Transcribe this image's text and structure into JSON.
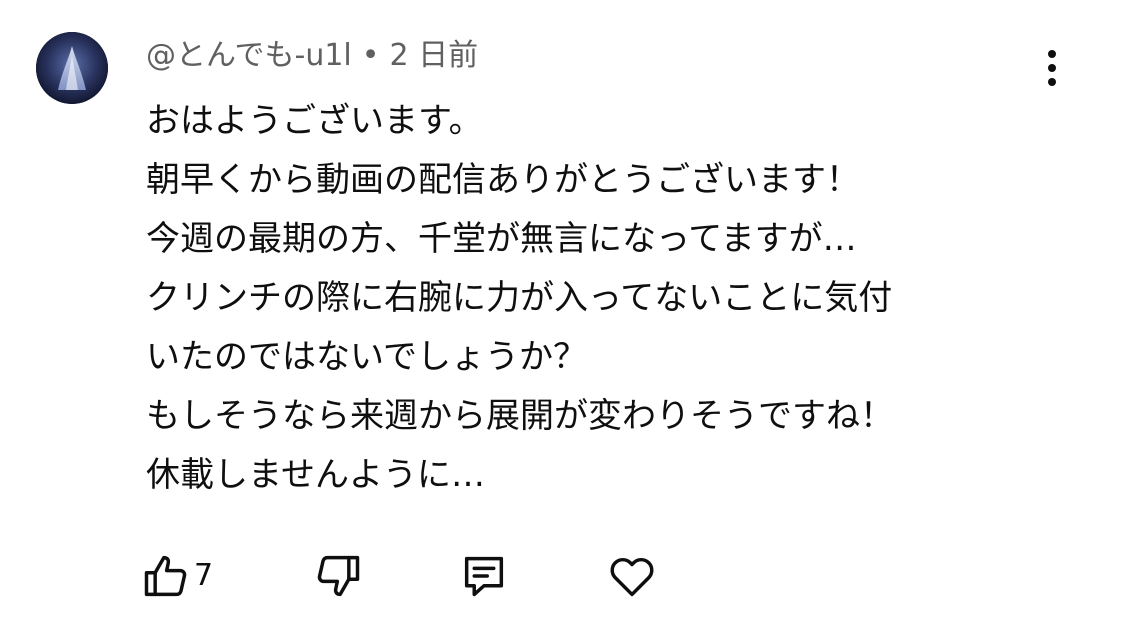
{
  "comment": {
    "author": "@とんでも-u1l",
    "separator": "•",
    "time": "2 日前",
    "body_lines": [
      "おはようございます。",
      "朝早くから動画の配信ありがとうございます！",
      "今週の最期の方、千堂が無言になってますが…",
      "クリンチの際に右腕に力が入ってないことに気付",
      "いたのではないでしょうか？",
      "もしそうなら来週から展開が変わりそうですね！",
      "休載しませんように…"
    ],
    "like_count": "7"
  },
  "icons": {
    "like": "thumbs-up-icon",
    "dislike": "thumbs-down-icon",
    "reply": "comment-icon",
    "heart": "heart-icon",
    "more": "more-vertical-icon"
  },
  "colors": {
    "text": "#0f0f0f",
    "meta": "#606060",
    "background": "#ffffff"
  }
}
